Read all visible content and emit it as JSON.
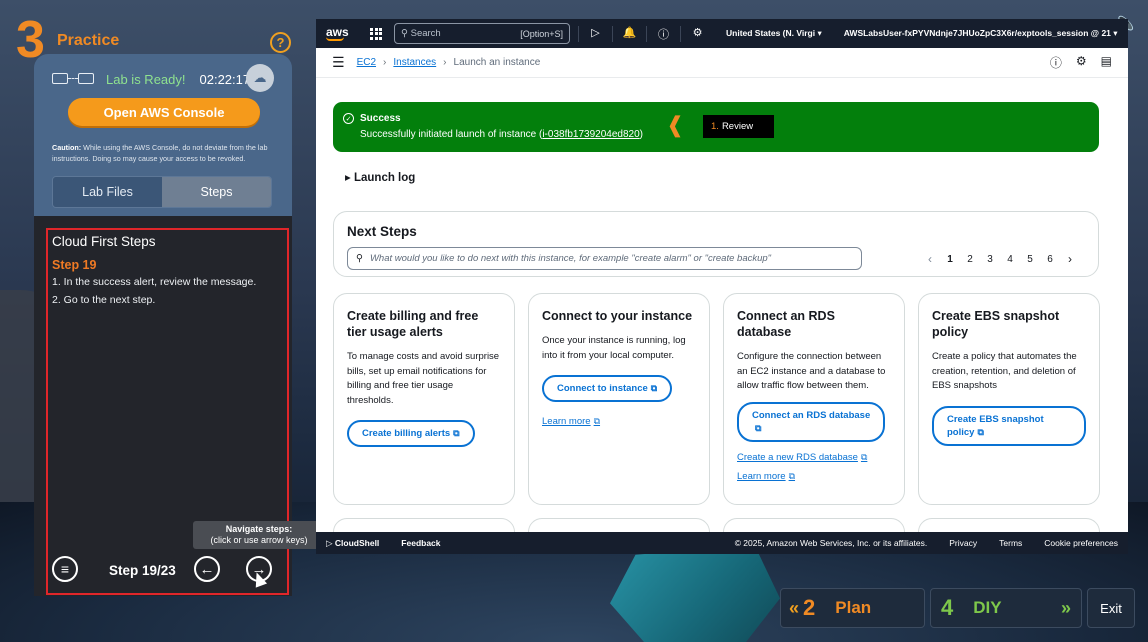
{
  "practice": {
    "number": "3",
    "label": "Practice",
    "help": "?"
  },
  "lab": {
    "status": "Lab is Ready!",
    "timer": "02:22:17",
    "open_console": "Open AWS Console",
    "caution_label": "Caution:",
    "caution_text": "While using the AWS Console, do not deviate from the lab instructions. Doing so may cause your access to be revoked.",
    "tabs": [
      "Lab Files",
      "Steps"
    ]
  },
  "steps": {
    "title": "Cloud First Steps",
    "step_label": "Step 19",
    "lines": [
      "1. In the success alert, review the message.",
      "2. Go to the next step."
    ],
    "counter": "Step 19/23",
    "tooltip_title": "Navigate steps:",
    "tooltip_sub": "(click or use arrow keys)"
  },
  "aws": {
    "logo": "aws",
    "search_placeholder": "Search",
    "search_hint": "[Option+S]",
    "region": "United States (N. Virgi",
    "account": "AWSLabsUser-fxPYVNdnje7JHUoZpC3X6r/exptools_session @ 21",
    "breadcrumb": [
      "EC2",
      "Instances",
      "Launch an instance"
    ],
    "success": {
      "title": "Success",
      "message": "Successfully initiated launch of instance (",
      "instance_id": "i-038fb1739204ed820",
      "message_end": ")"
    },
    "review": {
      "num": "1.",
      "label": "Review"
    },
    "launch_log": "Launch log",
    "next_steps": {
      "title": "Next Steps",
      "search_placeholder": "What would you like to do next with this instance, for example \"create alarm\" or \"create backup\"",
      "pages": [
        "1",
        "2",
        "3",
        "4",
        "5",
        "6"
      ]
    },
    "cards": [
      {
        "title": "Create billing and free tier usage alerts",
        "desc": "To manage costs and avoid surprise bills, set up email notifications for billing and free tier usage thresholds.",
        "button": "Create billing alerts"
      },
      {
        "title": "Connect to your instance",
        "desc": "Once your instance is running, log into it from your local computer.",
        "button": "Connect to instance",
        "link": "Learn more"
      },
      {
        "title": "Connect an RDS database",
        "desc": "Configure the connection between an EC2 instance and a database to allow traffic flow between them.",
        "button": "Connect an RDS database",
        "link": "Create a new RDS database",
        "link2": "Learn more"
      },
      {
        "title": "Create EBS snapshot policy",
        "desc": "Create a policy that automates the creation, retention, and deletion of EBS snapshots",
        "button": "Create EBS snapshot policy"
      }
    ],
    "footer": {
      "cloudshell": "CloudShell",
      "feedback": "Feedback",
      "copyright": "© 2025, Amazon Web Services, Inc. or its affiliates.",
      "privacy": "Privacy",
      "terms": "Terms",
      "cookies": "Cookie preferences"
    }
  },
  "nav": {
    "plan_num": "2",
    "plan_label": "Plan",
    "diy_num": "4",
    "diy_label": "DIY",
    "exit": "Exit"
  }
}
